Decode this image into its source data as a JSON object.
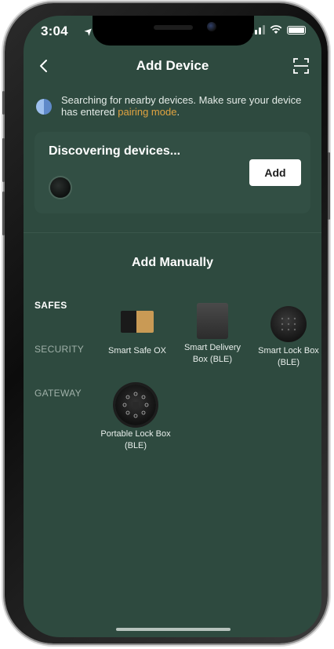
{
  "status_bar": {
    "time": "3:04"
  },
  "header": {
    "title": "Add Device"
  },
  "info": {
    "text": "Searching for nearby devices. Make sure your device has entered ",
    "link": "pairing mode",
    "suffix": "."
  },
  "discover": {
    "title": "Discovering devices...",
    "add_label": "Add"
  },
  "manual": {
    "title": "Add Manually"
  },
  "categories": [
    {
      "label": "SAFES",
      "active": true
    },
    {
      "label": "SECURITY",
      "active": false
    },
    {
      "label": "GATEWAY",
      "active": false
    }
  ],
  "devices": [
    {
      "label": "Smart Safe OX"
    },
    {
      "label": "Smart Delivery Box (BLE)"
    },
    {
      "label": "Smart Lock Box (BLE)"
    },
    {
      "label": "Portable Lock Box (BLE)"
    }
  ],
  "colors": {
    "background": "#2e4a3f",
    "card": "#324f44",
    "link": "#e0a340",
    "button": "#ffffff"
  }
}
